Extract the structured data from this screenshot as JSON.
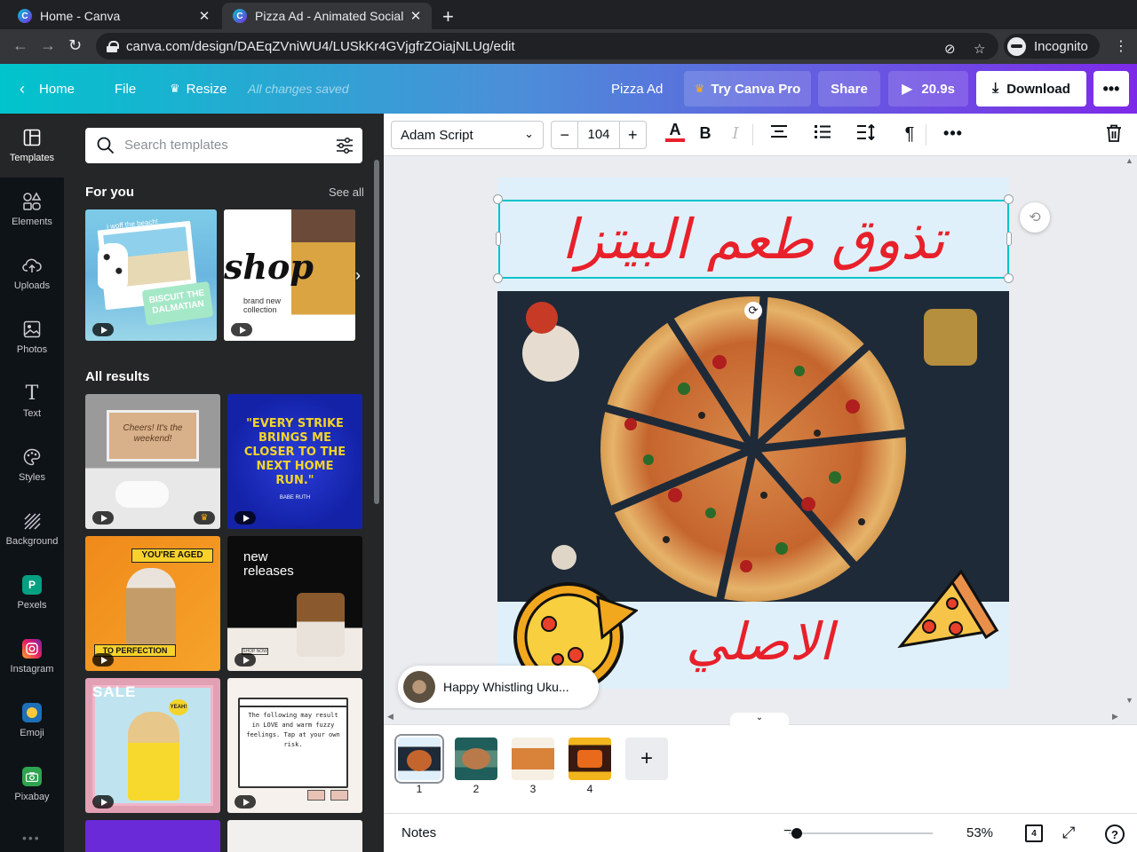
{
  "browser": {
    "tabs": [
      {
        "title": "Home - Canva",
        "favicon": "C"
      },
      {
        "title": "Pizza Ad - Animated Social",
        "favicon": "C"
      }
    ],
    "url": "canva.com/design/DAEqZVniWU4/LUSkKr4GVjgfrZOiajNLUg/edit",
    "profile": "Incognito"
  },
  "header": {
    "home": "Home",
    "file": "File",
    "resize": "Resize",
    "saved_status": "All changes saved",
    "design_title": "Pizza Ad",
    "try_pro": "Try Canva Pro",
    "share": "Share",
    "duration": "20.9s",
    "download": "Download"
  },
  "rail": {
    "items": [
      {
        "label": "Templates",
        "icon": "templates-icon"
      },
      {
        "label": "Elements",
        "icon": "elements-icon"
      },
      {
        "label": "Uploads",
        "icon": "uploads-icon"
      },
      {
        "label": "Photos",
        "icon": "photos-icon"
      },
      {
        "label": "Text",
        "icon": "text-icon"
      },
      {
        "label": "Styles",
        "icon": "styles-icon"
      },
      {
        "label": "Background",
        "icon": "background-icon"
      },
      {
        "label": "Pexels",
        "icon": "pexels-icon"
      },
      {
        "label": "Instagram",
        "icon": "instagram-icon"
      },
      {
        "label": "Emoji",
        "icon": "emoji-icon"
      },
      {
        "label": "Pixabay",
        "icon": "pixabay-icon"
      }
    ]
  },
  "panel": {
    "search_placeholder": "Search templates",
    "for_you": "For you",
    "see_all": "See all",
    "all_results": "All results",
    "for_you_cards": [
      {
        "title": "BISCUIT THE DALMATIAN",
        "caption": "i woff the beach!"
      },
      {
        "title": "shop",
        "caption": "brand new collection"
      }
    ],
    "result_cards": [
      {
        "text": "Cheers! It's the weekend!"
      },
      {
        "text": "\"EVERY STRIKE BRINGS ME CLOSER TO THE NEXT HOME RUN.\"",
        "sub": "BABE RUTH"
      },
      {
        "text": "YOU'RE AGED",
        "sub": "TO PERFECTION"
      },
      {
        "text": "new releases",
        "sub": "SHOP NOW"
      },
      {
        "text": "SALE",
        "sub": "YEAH!"
      },
      {
        "text": "The following may result in LOVE and warm fuzzy feelings. Tap at your own risk."
      }
    ]
  },
  "toolbar": {
    "font": "Adam Script",
    "font_size": "104"
  },
  "canvas": {
    "headline": "تذوق طعم البيتزا",
    "footer_word": "الاصلي"
  },
  "audio": {
    "track": "Happy Whistling Uku..."
  },
  "pages": {
    "items": [
      "1",
      "2",
      "3",
      "4"
    ],
    "count": "4"
  },
  "footer": {
    "notes": "Notes",
    "zoom": "53%",
    "help": "?"
  },
  "colors": {
    "accent": "#00c4cc",
    "brand_purple": "#7d2ae8",
    "headline_red": "#e8202a",
    "crown": "#ffb200"
  }
}
